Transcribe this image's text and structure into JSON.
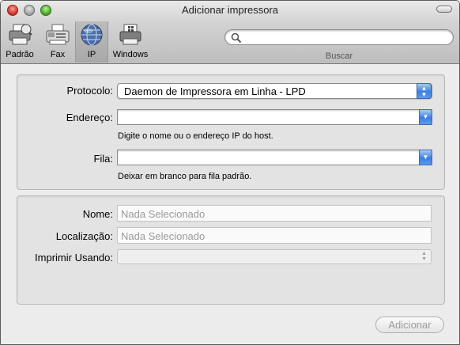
{
  "window": {
    "title": "Adicionar impressora"
  },
  "toolbar": {
    "items": [
      {
        "label": "Padrão",
        "icon": "printer-default-icon"
      },
      {
        "label": "Fax",
        "icon": "fax-icon"
      },
      {
        "label": "IP",
        "icon": "globe-ip-icon",
        "selected": true
      },
      {
        "label": "Windows",
        "icon": "windows-printer-icon"
      }
    ],
    "search": {
      "placeholder": "",
      "value": "",
      "label": "Buscar"
    }
  },
  "form": {
    "protocol": {
      "label": "Protocolo:",
      "value": "Daemon de Impressora em Linha - LPD"
    },
    "address": {
      "label": "Endereço:",
      "value": "",
      "hint": "Digite o nome ou o endereço IP do host."
    },
    "queue": {
      "label": "Fila:",
      "value": "",
      "hint": "Deixar em branco para fila padrão."
    }
  },
  "details": {
    "name": {
      "label": "Nome:",
      "placeholder": "Nada Selecionado"
    },
    "location": {
      "label": "Localização:",
      "placeholder": "Nada Selecionado"
    },
    "print_using": {
      "label": "Imprimir Usando:",
      "value": ""
    }
  },
  "actions": {
    "add_label": "Adicionar"
  },
  "colors": {
    "accent_blue": "#3c7fe0",
    "window_bg": "#ececec",
    "panel_bg": "#e3e3e3"
  }
}
